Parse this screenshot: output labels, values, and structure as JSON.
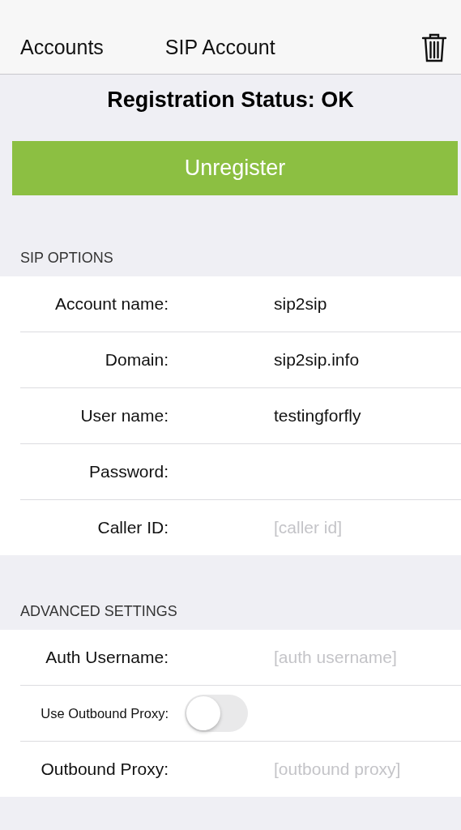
{
  "nav": {
    "back": "Accounts",
    "title": "SIP Account"
  },
  "status": "Registration Status: OK",
  "action_button": "Unregister",
  "sections": [
    {
      "header": "SIP OPTIONS",
      "rows": [
        {
          "kind": "field",
          "label": "Account name:",
          "value": "sip2sip"
        },
        {
          "kind": "field",
          "label": "Domain:",
          "value": "sip2sip.info"
        },
        {
          "kind": "field",
          "label": "User name:",
          "value": "testingforfly"
        },
        {
          "kind": "field",
          "label": "Password:"
        },
        {
          "kind": "field",
          "label": "Caller ID:",
          "placeholder": "[caller id]"
        }
      ]
    },
    {
      "header": "ADVANCED SETTINGS",
      "rows": [
        {
          "kind": "field",
          "label": "Auth Username:",
          "placeholder": "[auth username]"
        },
        {
          "kind": "toggle",
          "label": "Use Outbound Proxy:",
          "on": false
        },
        {
          "kind": "field",
          "label": "Outbound Proxy:",
          "placeholder": "[outbound proxy]"
        }
      ]
    }
  ]
}
